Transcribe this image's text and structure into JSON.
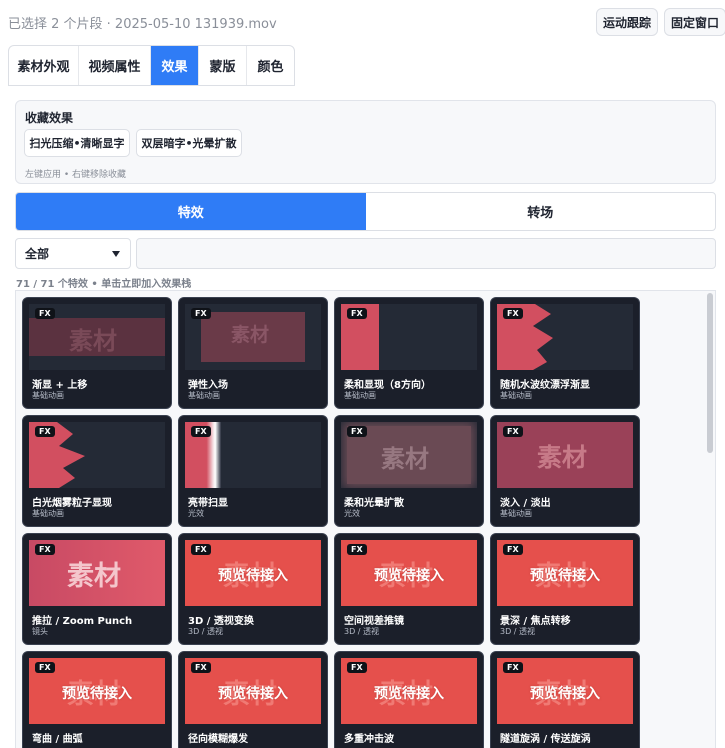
{
  "header": {
    "info": "已选择 2 个片段 · 2025-05-10 131939.mov",
    "buttons": [
      "运动跟踪",
      "固定窗口"
    ]
  },
  "tabs": [
    {
      "label": "素材外观",
      "active": false
    },
    {
      "label": "视频属性",
      "active": false
    },
    {
      "label": "效果",
      "active": true
    },
    {
      "label": "蒙版",
      "active": false
    },
    {
      "label": "颜色",
      "active": false
    }
  ],
  "favorites": {
    "title": "收藏效果",
    "chips": [
      "扫光压缩•清晰显字",
      "双层暗字•光晕扩散"
    ],
    "hint": "左键应用 • 右键移除收藏"
  },
  "segments": [
    {
      "label": "特效",
      "active": true
    },
    {
      "label": "转场",
      "active": false
    }
  ],
  "filter": {
    "select_value": "全部",
    "search_value": "",
    "count_text": "71 / 71 个特效 • 单击立即加入效果栈"
  },
  "fx_badge": "FX",
  "preview_words": {
    "material": "素材",
    "pending": "预览待接入"
  },
  "colors": {
    "accent": "#2f7cf6",
    "card_bg": "#1b1f2a",
    "pink": "#d24f60",
    "red": "#e5504c"
  },
  "cards": [
    {
      "name": "渐显 + 上移",
      "sub": "基础动画"
    },
    {
      "name": "弹性入场",
      "sub": "基础动画"
    },
    {
      "name": "柔和显现（8方向）",
      "sub": "基础动画"
    },
    {
      "name": "随机水波纹漂浮渐显",
      "sub": "基础动画"
    },
    {
      "name": "白光烟雾粒子显现",
      "sub": "基础动画"
    },
    {
      "name": "亮带扫显",
      "sub": "光效"
    },
    {
      "name": "柔和光晕扩散",
      "sub": "光效"
    },
    {
      "name": "淡入 / 淡出",
      "sub": "基础动画"
    },
    {
      "name": "推拉 / Zoom Punch",
      "sub": "镜头"
    },
    {
      "name": "3D / 透视变换",
      "sub": "3D / 透视"
    },
    {
      "name": "空间视差推镜",
      "sub": "3D / 透视"
    },
    {
      "name": "景深 / 焦点转移",
      "sub": "3D / 透视"
    },
    {
      "name": "弯曲 / 曲弧",
      "sub": ""
    },
    {
      "name": "径向模糊爆发",
      "sub": ""
    },
    {
      "name": "多重冲击波",
      "sub": ""
    },
    {
      "name": "隧道旋涡 / 传送旋涡",
      "sub": ""
    }
  ]
}
